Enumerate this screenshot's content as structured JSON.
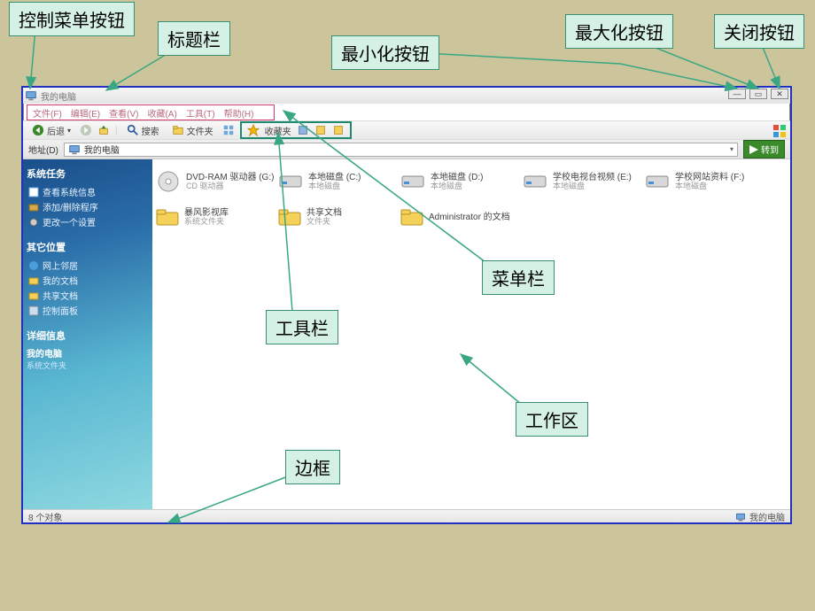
{
  "callouts": {
    "control_menu": "控制菜单按钮",
    "titlebar": "标题栏",
    "minimize": "最小化按钮",
    "maximize": "最大化按钮",
    "close": "关闭按钮",
    "menubar": "菜单栏",
    "toolbar": "工具栏",
    "workarea": "工作区",
    "border": "边框"
  },
  "window": {
    "title": "我的电脑",
    "menus": [
      "文件(F)",
      "编辑(E)",
      "查看(V)",
      "收藏(A)",
      "工具(T)",
      "帮助(H)"
    ],
    "toolbar": {
      "back": "后退",
      "search": "搜索",
      "folders": "文件夹",
      "favorites": "收藏夹"
    },
    "address": {
      "label": "地址(D)",
      "value": "我的电脑",
      "go": "转到"
    },
    "sidebar": {
      "section1_title": "系统任务",
      "s1_items": [
        "查看系统信息",
        "添加/删除程序",
        "更改一个设置"
      ],
      "section2_title": "其它位置",
      "s2_items": [
        "网上邻居",
        "我的文档",
        "共享文档",
        "控制面板"
      ],
      "section3_title": "详细信息",
      "s3_name": "我的电脑",
      "s3_sub": "系统文件夹"
    },
    "drives": [
      {
        "name": "DVD-RAM 驱动器 (G:)",
        "sub": "CD 驱动器",
        "type": "cd"
      },
      {
        "name": "本地磁盘 (C:)",
        "sub": "本地磁盘",
        "type": "hdd"
      },
      {
        "name": "本地磁盘 (D:)",
        "sub": "本地磁盘",
        "type": "hdd"
      },
      {
        "name": "学校电视台视频 (E:)",
        "sub": "本地磁盘",
        "type": "hdd"
      },
      {
        "name": "学校网站资料 (F:)",
        "sub": "本地磁盘",
        "type": "hdd"
      }
    ],
    "folders": [
      {
        "name": "暴风影视库",
        "sub": "系统文件夹"
      },
      {
        "name": "共享文档",
        "sub": "文件夹"
      },
      {
        "name": "Administrator 的文档",
        "sub": ""
      }
    ],
    "status": {
      "left": "8 个对象",
      "right": "我的电脑"
    }
  }
}
